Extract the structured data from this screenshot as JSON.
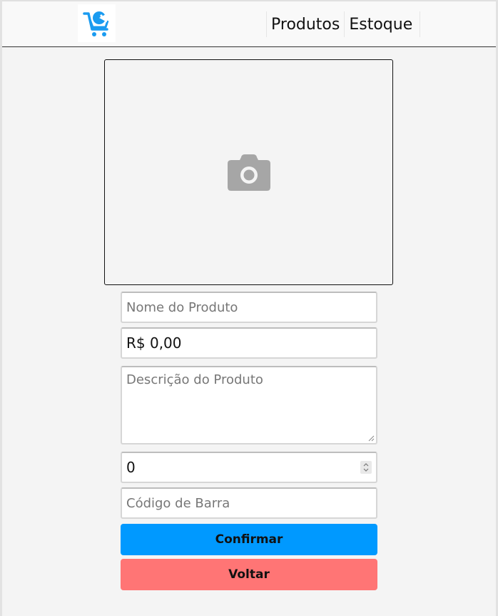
{
  "navbar": {
    "logo_icon": "shopping-cart-logo-icon",
    "links": [
      {
        "label": "Produtos"
      },
      {
        "label": "Estoque"
      }
    ]
  },
  "image_upload": {
    "icon": "camera-icon"
  },
  "form": {
    "name_placeholder": "Nome do Produto",
    "price_value": "R$ 0,00",
    "description_placeholder": "Descrição do Produto",
    "quantity_value": "0",
    "barcode_placeholder": "Código de Barra"
  },
  "buttons": {
    "confirm_label": "Confirmar",
    "back_label": "Voltar"
  },
  "colors": {
    "brand_blue": "#0099ff",
    "back_red": "#ff7575",
    "camera_gray": "#a6a6a6"
  }
}
